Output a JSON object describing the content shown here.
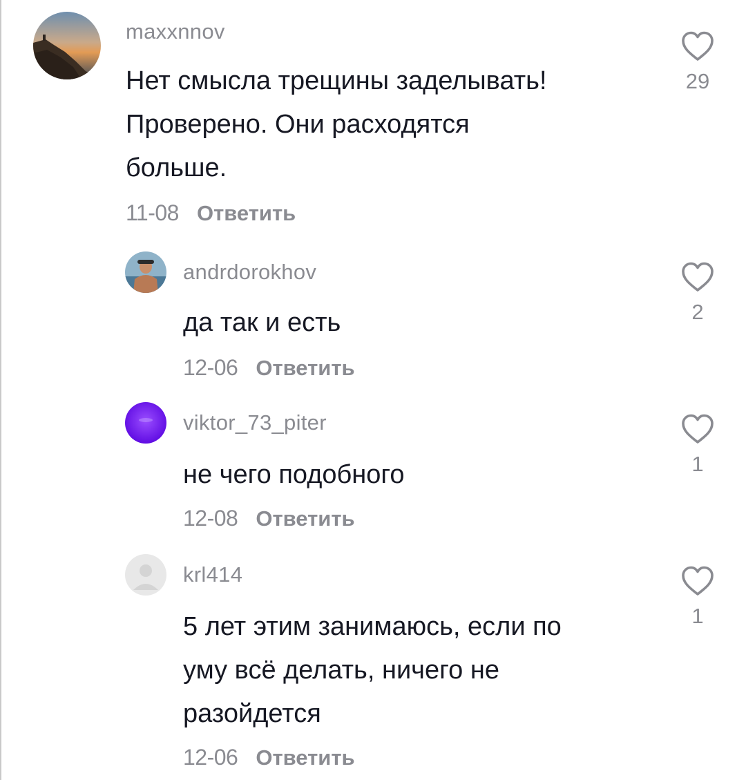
{
  "comments": [
    {
      "username": "maxxnnov",
      "text": "Нет смысла трещины заделывать!\nПроверено. Они расходятся\nбольше.",
      "date": "11-08",
      "reply_label": "Ответить",
      "likes": "29"
    },
    {
      "username": "andrdorokhov",
      "text": "да так и есть",
      "date": "12-06",
      "reply_label": "Ответить",
      "likes": "2"
    },
    {
      "username": "viktor_73_piter",
      "text": "не чего подобного",
      "date": "12-08",
      "reply_label": "Ответить",
      "likes": "1"
    },
    {
      "username": "krl414",
      "text": "5 лет этим занимаюсь, если по\nуму всё делать, ничего не\nразойдется",
      "date": "12-06",
      "reply_label": "Ответить",
      "likes": "1"
    }
  ],
  "icons": {
    "like": "heart-outline-icon"
  },
  "colors": {
    "text": "#161823",
    "muted": "#8a8b91",
    "background": "#ffffff"
  }
}
